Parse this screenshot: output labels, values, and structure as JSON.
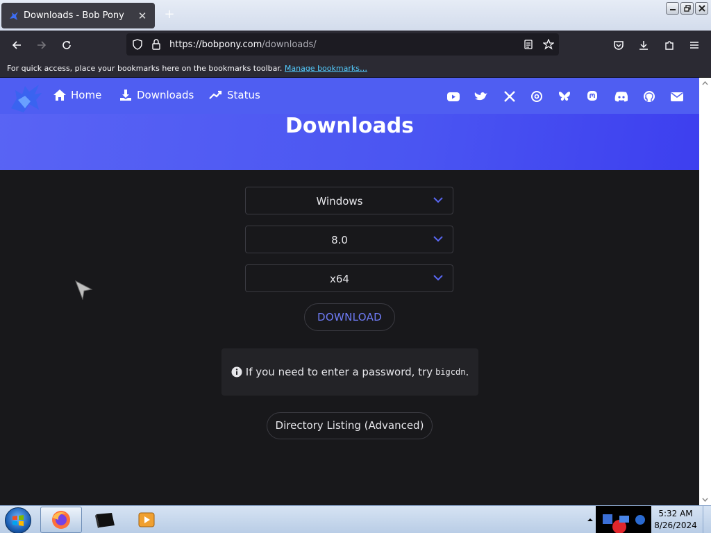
{
  "browser": {
    "tab_title": "Downloads - Bob Pony",
    "new_tab_symbol": "+",
    "close_symbol": "✕",
    "url_host": "https://bobpony.com",
    "url_path": "/downloads/",
    "bookmarks_text": "For quick access, place your bookmarks here on the bookmarks toolbar.",
    "bookmarks_link": "Manage bookmarks…"
  },
  "site": {
    "nav": [
      {
        "label": "Home",
        "icon": "home-icon"
      },
      {
        "label": "Downloads",
        "icon": "download-icon"
      },
      {
        "label": "Status",
        "icon": "chart-icon"
      }
    ],
    "social_icons": [
      "youtube-icon",
      "twitter-icon",
      "x-icon",
      "threads-icon",
      "bluesky-icon",
      "mastodon-icon",
      "discord-icon",
      "github-icon",
      "mail-icon"
    ],
    "title": "Downloads"
  },
  "form": {
    "os": "Windows",
    "version": "8.0",
    "arch": "x64",
    "download_label": "DOWNLOAD",
    "notice_text": "If you need to enter a password, try",
    "notice_code": "bigcdn",
    "notice_end": ".",
    "directory_label": "Directory Listing (Advanced)"
  },
  "taskbar": {
    "time": "5:32 AM",
    "date": "8/26/2024"
  },
  "colors": {
    "accent": "#4f5ef2",
    "download_text": "#6f7cf7",
    "page_bg": "#18181b"
  }
}
